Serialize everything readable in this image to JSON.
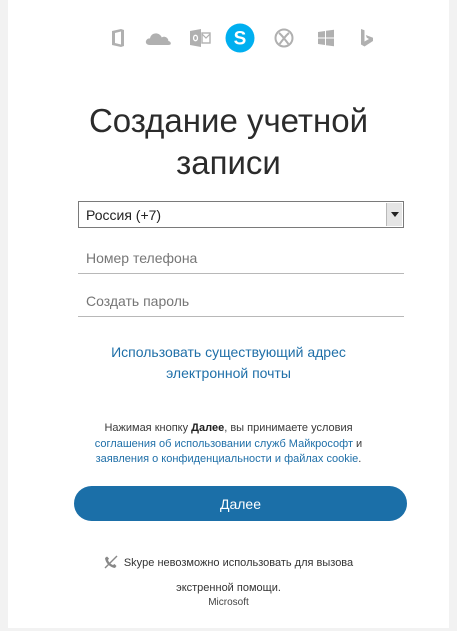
{
  "apps": [
    {
      "name": "office-icon",
      "color": "#b0b0b0",
      "active": false
    },
    {
      "name": "onedrive-icon",
      "color": "#b0b0b0",
      "active": false
    },
    {
      "name": "outlook-icon",
      "color": "#b0b0b0",
      "active": false
    },
    {
      "name": "skype-icon",
      "color": "#00aff0",
      "active": true
    },
    {
      "name": "xbox-icon",
      "color": "#b0b0b0",
      "active": false
    },
    {
      "name": "windows-icon",
      "color": "#b0b0b0",
      "active": false
    },
    {
      "name": "bing-icon",
      "color": "#b0b0b0",
      "active": false
    }
  ],
  "form": {
    "title_line1": "Создание учетной",
    "title_line2": "записи",
    "country_value": "Россия (+7)",
    "phone_placeholder": "Номер телефона",
    "password_placeholder": "Создать пароль",
    "use_email_line1": "Использовать существующий адрес",
    "use_email_line2": "электронной почты",
    "terms_prefix": "Нажимая кнопку ",
    "terms_bold": "Далее",
    "terms_suffix": ", вы принимаете условия",
    "terms_link1": "соглашения об использовании служб Майкрософт",
    "terms_and": " и",
    "terms_link2": "заявления о конфиденциальности и файлах cookie",
    "terms_end": ".",
    "next_label": "Далее"
  },
  "notice": {
    "line1": "Skype невозможно использовать для вызова",
    "line2": "экстренной помощи."
  },
  "footer": {
    "brand": "Microsoft"
  },
  "colors": {
    "accent": "#1b6fa8",
    "link": "#1f6fa8",
    "skype": "#00aff0"
  }
}
